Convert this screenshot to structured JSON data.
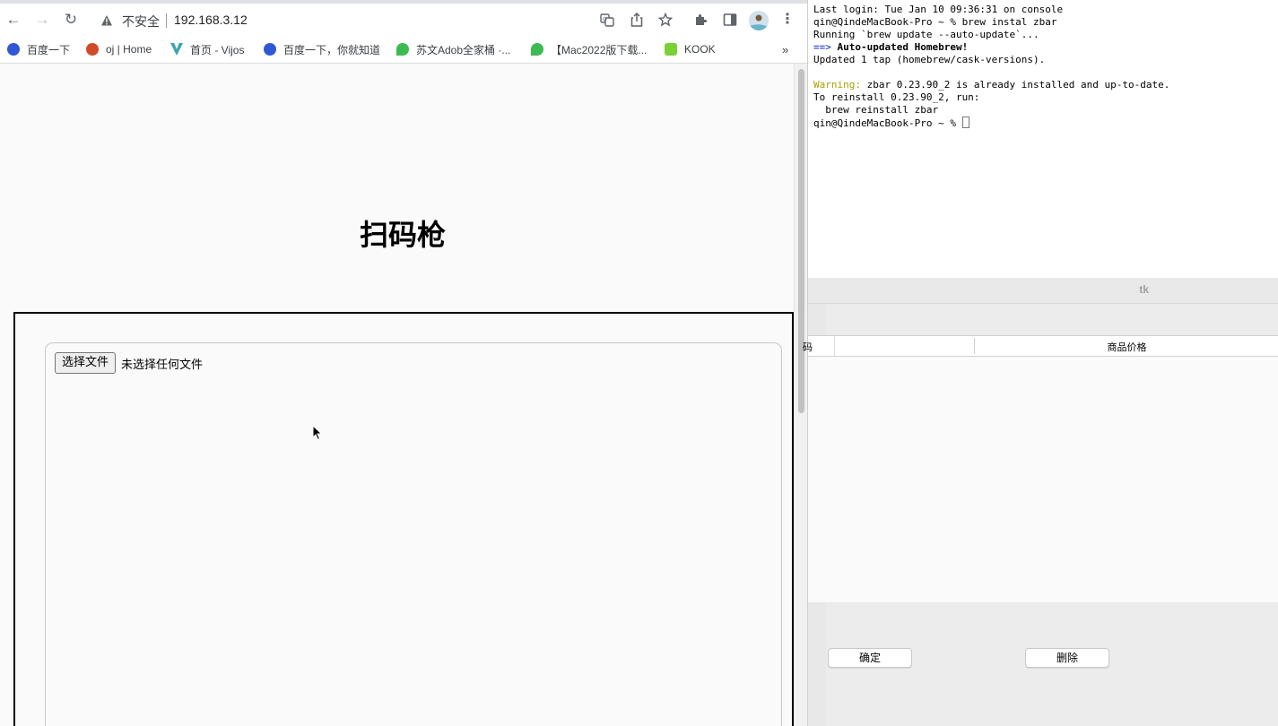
{
  "browser": {
    "security_label": "不安全",
    "url": "192.168.3.12",
    "bookmarks": [
      {
        "label": "百度一下",
        "icon": "baidu-paw-icon",
        "color": "#3058d6"
      },
      {
        "label": "oj | Home",
        "icon": "lollipop-icon",
        "color": "#d04a2a"
      },
      {
        "label": "首页 - Vijos",
        "icon": "vijos-icon",
        "color": "#39a6b0"
      },
      {
        "label": "百度一下，你就知道",
        "icon": "baidu-paw-icon",
        "color": "#3058d6"
      },
      {
        "label": "苏文Adob全家桶 ·...",
        "icon": "leaf-icon",
        "color": "#3dbb52"
      },
      {
        "label": "【Mac2022版下载...",
        "icon": "leaf-icon",
        "color": "#3dbb52"
      },
      {
        "label": "KOOK",
        "icon": "kook-icon",
        "color": "#79d136"
      }
    ],
    "more_bookmarks": "»"
  },
  "page": {
    "title": "扫码枪",
    "file_button": "选择文件",
    "file_status": "未选择任何文件"
  },
  "terminal": {
    "line1": "Last login: Tue Jan 10 09:36:31 on console",
    "line2": "qin@QindeMacBook-Pro ~ % brew instal zbar",
    "line3": "Running `brew update --auto-update`...",
    "line4_arrow": "==>",
    "line4_text": "Auto-updated Homebrew!",
    "line5": "Updated 1 tap (homebrew/cask-versions).",
    "line7_warning": "Warning:",
    "line7_text": " zbar 0.23.90_2 is already installed and up-to-date.",
    "line8": "To reinstall 0.23.90_2, run:",
    "line9": "  brew reinstall zbar",
    "line10": "qin@QindeMacBook-Pro ~ % "
  },
  "tk": {
    "title": "tk",
    "col1_header": "码",
    "col2_header": "商品价格",
    "confirm_button": "确定",
    "delete_button": "删除"
  }
}
